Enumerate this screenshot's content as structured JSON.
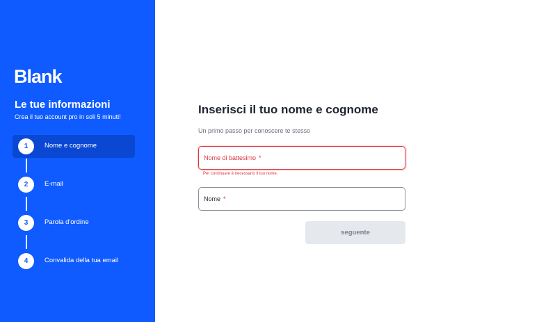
{
  "sidebar": {
    "logo": "Blank",
    "title": "Le tue informazioni",
    "subtitle": "Crea il tuo account pro in soli 5 minuti!",
    "steps": [
      {
        "number": "1",
        "label": "Nome e cognome"
      },
      {
        "number": "2",
        "label": "E-mail"
      },
      {
        "number": "3",
        "label": "Parola d'ordine"
      },
      {
        "number": "4",
        "label": "Convalida della tua email"
      }
    ]
  },
  "main": {
    "title": "Inserisci il tuo nome e cognome",
    "subtitle": "Un primo passo per conoscere te stesso",
    "first_name_label": "Nome di battesimo",
    "first_name_error": "Per continuare è necessario il tuo nome.",
    "last_name_label": "Nome",
    "required_mark": "*",
    "next_label": "seguente"
  },
  "colors": {
    "brand": "#0f5bff",
    "error": "#d9363e"
  }
}
